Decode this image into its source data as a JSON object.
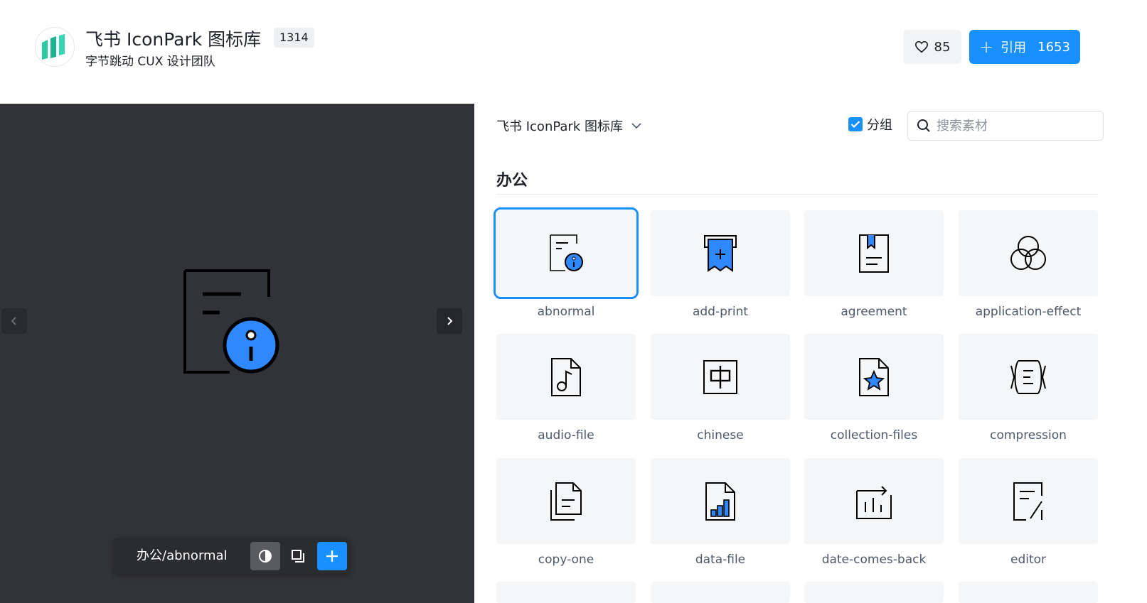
{
  "header": {
    "title": "飞书 IconPark 图标库",
    "count": "1314",
    "subtitle": "字节跳动 CUX 设计团队",
    "likes": "85",
    "cite_label": "引用",
    "cite_count": "1653"
  },
  "preview": {
    "path": "办公/abnormal",
    "icon": "abnormal-icon"
  },
  "panel": {
    "library_select": "飞书 IconPark 图标库",
    "group_label": "分组",
    "group_checked": true,
    "search_placeholder": "搜索素材",
    "section_title": "办公",
    "icons": [
      {
        "label": "abnormal",
        "icon": "abnormal-icon",
        "selected": true
      },
      {
        "label": "add-print",
        "icon": "add-print-icon"
      },
      {
        "label": "agreement",
        "icon": "agreement-icon"
      },
      {
        "label": "application-effect",
        "icon": "application-effect-icon"
      },
      {
        "label": "audio-file",
        "icon": "audio-file-icon"
      },
      {
        "label": "chinese",
        "icon": "chinese-icon"
      },
      {
        "label": "collection-files",
        "icon": "collection-files-icon"
      },
      {
        "label": "compression",
        "icon": "compression-icon"
      },
      {
        "label": "copy-one",
        "icon": "copy-one-icon"
      },
      {
        "label": "data-file",
        "icon": "data-file-icon"
      },
      {
        "label": "date-comes-back",
        "icon": "date-comes-back-icon"
      },
      {
        "label": "editor",
        "icon": "editor-icon"
      }
    ]
  },
  "colors": {
    "accent": "#1890ff",
    "icon_fill": "#2f88ff",
    "preview_bg": "#323338"
  }
}
